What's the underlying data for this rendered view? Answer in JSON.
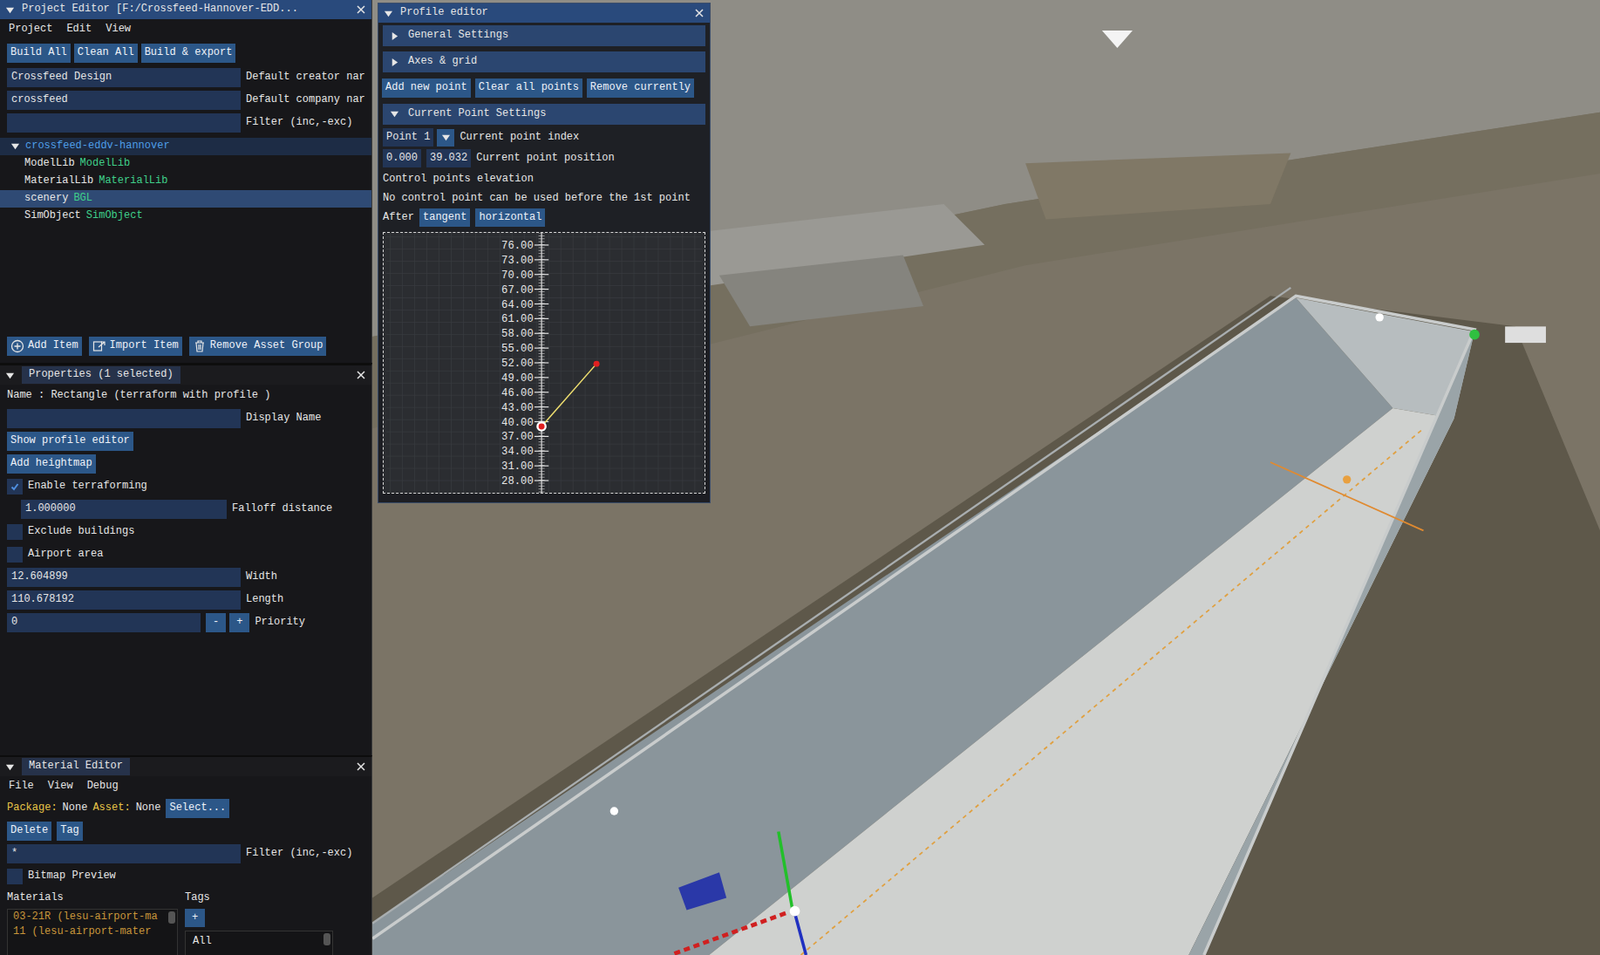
{
  "project_editor": {
    "title": "Project Editor [F:/Crossfeed-Hannover-EDD...",
    "menu": [
      "Project",
      "Edit",
      "View"
    ],
    "toolbar": [
      "Build All",
      "Clean All",
      "Build & export"
    ],
    "fields": [
      {
        "value": "Crossfeed Design",
        "label": "Default creator nar"
      },
      {
        "value": "crossfeed",
        "label": "Default company nar"
      },
      {
        "value": "",
        "label": "Filter (inc,-exc)"
      }
    ],
    "tree": {
      "label": "crossfeed-eddv-hannover",
      "expanded": true,
      "children": [
        {
          "name": "ModelLib",
          "type": "ModelLib",
          "selected": false
        },
        {
          "name": "MaterialLib",
          "type": "MaterialLib",
          "selected": false
        },
        {
          "name": "scenery",
          "type": "BGL",
          "selected": true
        },
        {
          "name": "SimObject",
          "type": "SimObject",
          "selected": false
        }
      ]
    },
    "actions": [
      "Add Item",
      "Import Item",
      "Remove Asset Group"
    ]
  },
  "properties": {
    "title": "Properties (1 selected)",
    "name_line": "Name : Rectangle (terraform with profile )",
    "display_name": {
      "value": "",
      "label": "Display Name"
    },
    "buttons": [
      "Show profile editor",
      "Add heightmap"
    ],
    "rows": [
      {
        "kind": "checkbox",
        "label": "Enable terraforming",
        "checked": true
      },
      {
        "kind": "subfield",
        "value": "1.000000",
        "label": "Falloff distance"
      },
      {
        "kind": "checkbox",
        "label": "Exclude buildings",
        "checked": false
      },
      {
        "kind": "checkbox",
        "label": "Airport area",
        "checked": false
      },
      {
        "kind": "field",
        "value": "12.604899",
        "label": "Width"
      },
      {
        "kind": "field",
        "value": "110.678192",
        "label": "Length"
      },
      {
        "kind": "stepper",
        "value": "0",
        "label": "Priority",
        "minus": "-",
        "plus": "+"
      }
    ]
  },
  "material_editor": {
    "title": "Material Editor",
    "menu": [
      "File",
      "View",
      "Debug"
    ],
    "package_label": "Package:",
    "package": "None",
    "asset_label": "Asset:",
    "asset": "None",
    "select": "Select...",
    "buttons": [
      "Delete",
      "Tag"
    ],
    "filter": {
      "value": "*",
      "label": "Filter (inc,-exc)"
    },
    "bitmap_preview": {
      "label": "Bitmap Preview",
      "checked": false
    },
    "materials_header": "Materials",
    "tags_header": "Tags",
    "materials": [
      "03-21R (lesu-airport-ma",
      "11 (lesu-airport-mater"
    ],
    "tag_add": "+",
    "tags": [
      "All"
    ]
  },
  "profile_editor": {
    "title": "Profile editor",
    "sections": [
      {
        "label": "General Settings",
        "expanded": false
      },
      {
        "label": "Axes & grid",
        "expanded": false
      }
    ],
    "buttons": [
      "Add new point",
      "Clear all points",
      "Remove currently"
    ],
    "current": {
      "label": "Current Point Settings",
      "expanded": true
    },
    "point_index": {
      "value": "Point 1",
      "label": "Current point index"
    },
    "position": {
      "x": "0.000",
      "y": "39.032",
      "label": "Current point position"
    },
    "elevation_label": "Control points elevation",
    "note": "No control point can be used before the 1st point",
    "after_label": "After",
    "after_options": [
      "tangent",
      "horizontal"
    ],
    "chart": {
      "y_ticks": [
        "76.00",
        "73.00",
        "70.00",
        "67.00",
        "64.00",
        "61.00",
        "58.00",
        "55.00",
        "52.00",
        "49.00",
        "46.00",
        "43.00",
        "40.00",
        "37.00",
        "34.00",
        "31.00",
        "28.00"
      ],
      "points": [
        {
          "x": 0,
          "y": 39.032,
          "selected": true
        },
        {
          "x": 11.2,
          "y": 51.8,
          "selected": false
        }
      ]
    }
  }
}
